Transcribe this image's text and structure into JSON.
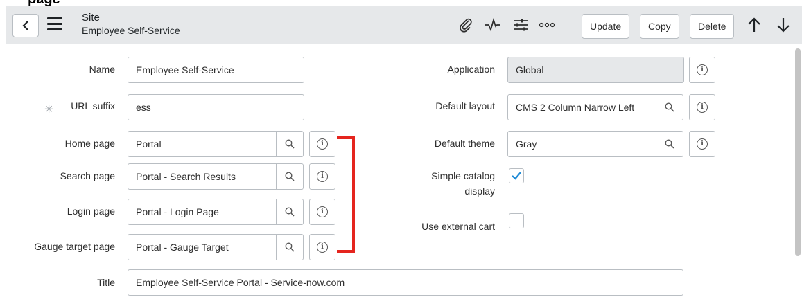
{
  "top_fragment": "page",
  "header": {
    "record_type": "Site",
    "record_name": "Employee Self-Service",
    "buttons": {
      "update": "Update",
      "copy": "Copy",
      "delete": "Delete"
    }
  },
  "form": {
    "left": {
      "name": {
        "label": "Name",
        "value": "Employee Self-Service"
      },
      "url_suffix": {
        "label": "URL suffix",
        "value": "ess"
      },
      "home_page": {
        "label": "Home page",
        "value": "Portal"
      },
      "search_page": {
        "label": "Search page",
        "value": "Portal - Search Results"
      },
      "login_page": {
        "label": "Login page",
        "value": "Portal - Login Page"
      },
      "gauge_target_page": {
        "label": "Gauge target page",
        "value": "Portal - Gauge Target"
      },
      "title": {
        "label": "Title",
        "value": "Employee Self-Service Portal - Service-now.com"
      }
    },
    "right": {
      "application": {
        "label": "Application",
        "value": "Global"
      },
      "default_layout": {
        "label": "Default layout",
        "value": "CMS 2 Column Narrow Left"
      },
      "default_theme": {
        "label": "Default theme",
        "value": "Gray"
      },
      "simple_catalog_display": {
        "label_line1": "Simple catalog",
        "label_line2": "display",
        "checked": true
      },
      "use_external_cart": {
        "label": "Use external cart",
        "checked": false
      }
    }
  },
  "colors": {
    "accent": "#e5251e",
    "check": "#1f8bd6",
    "header_bg": "#e6e8ea"
  }
}
